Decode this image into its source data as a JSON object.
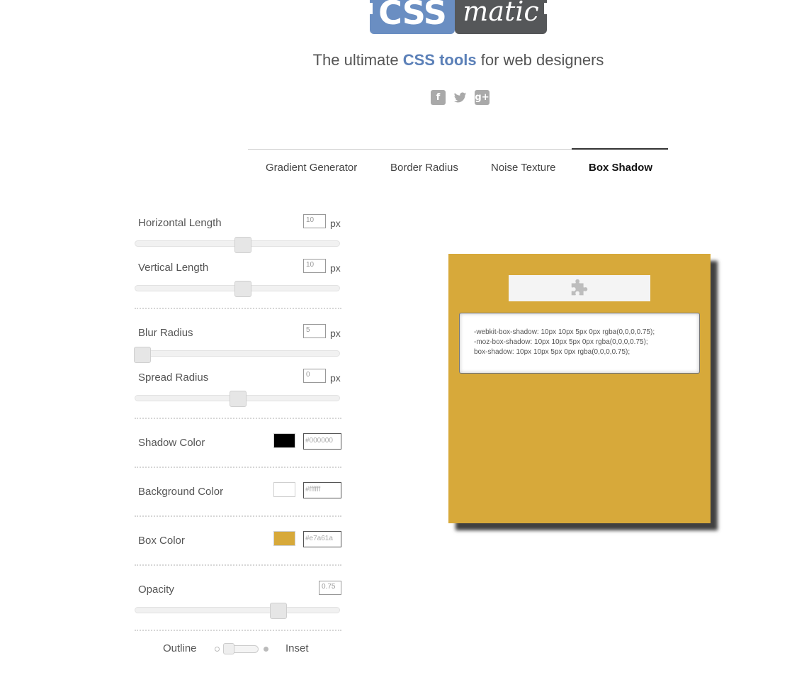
{
  "logo": {
    "css": "CSS",
    "matic": "matic"
  },
  "tagline": {
    "before": "The ultimate ",
    "highlight": "CSS tools",
    "after": " for web designers"
  },
  "social": {
    "facebook": "f",
    "twitter": "🐦",
    "googleplus": "g+"
  },
  "tabs": [
    {
      "label": "Gradient Generator",
      "active": false
    },
    {
      "label": "Border Radius",
      "active": false
    },
    {
      "label": "Noise Texture",
      "active": false
    },
    {
      "label": "Box Shadow",
      "active": true
    }
  ],
  "controls": {
    "horizontal": {
      "label": "Horizontal Length",
      "value": "10",
      "unit": "px",
      "slider_fraction": 0.52
    },
    "vertical": {
      "label": "Vertical Length",
      "value": "10",
      "unit": "px",
      "slider_fraction": 0.52
    },
    "blur": {
      "label": "Blur Radius",
      "value": "5",
      "unit": "px",
      "slider_fraction": 0.0
    },
    "spread": {
      "label": "Spread Radius",
      "value": "0",
      "unit": "px",
      "slider_fraction": 0.5
    },
    "shadow_color": {
      "label": "Shadow Color",
      "value": "#000000",
      "swatch": "#000000"
    },
    "background_color": {
      "label": "Background Color",
      "value": "#ffffff",
      "swatch": "#ffffff"
    },
    "box_color": {
      "label": "Box Color",
      "value": "#e7a61a",
      "swatch": "#d7a93a"
    },
    "opacity": {
      "label": "Opacity",
      "value": "0.75",
      "slider_fraction": 0.75
    },
    "toggle": {
      "outline": "Outline",
      "inset": "Inset"
    }
  },
  "preview": {
    "box_color": "#d7a93a",
    "icon": "puzzle-icon",
    "code": {
      "line1": "-webkit-box-shadow: 10px 10px 5px 0px rgba(0,0,0,0.75);",
      "line2": "-moz-box-shadow: 10px 10px 5px 0px rgba(0,0,0,0.75);",
      "line3": "box-shadow: 10px 10px 5px 0px rgba(0,0,0,0.75);"
    }
  }
}
